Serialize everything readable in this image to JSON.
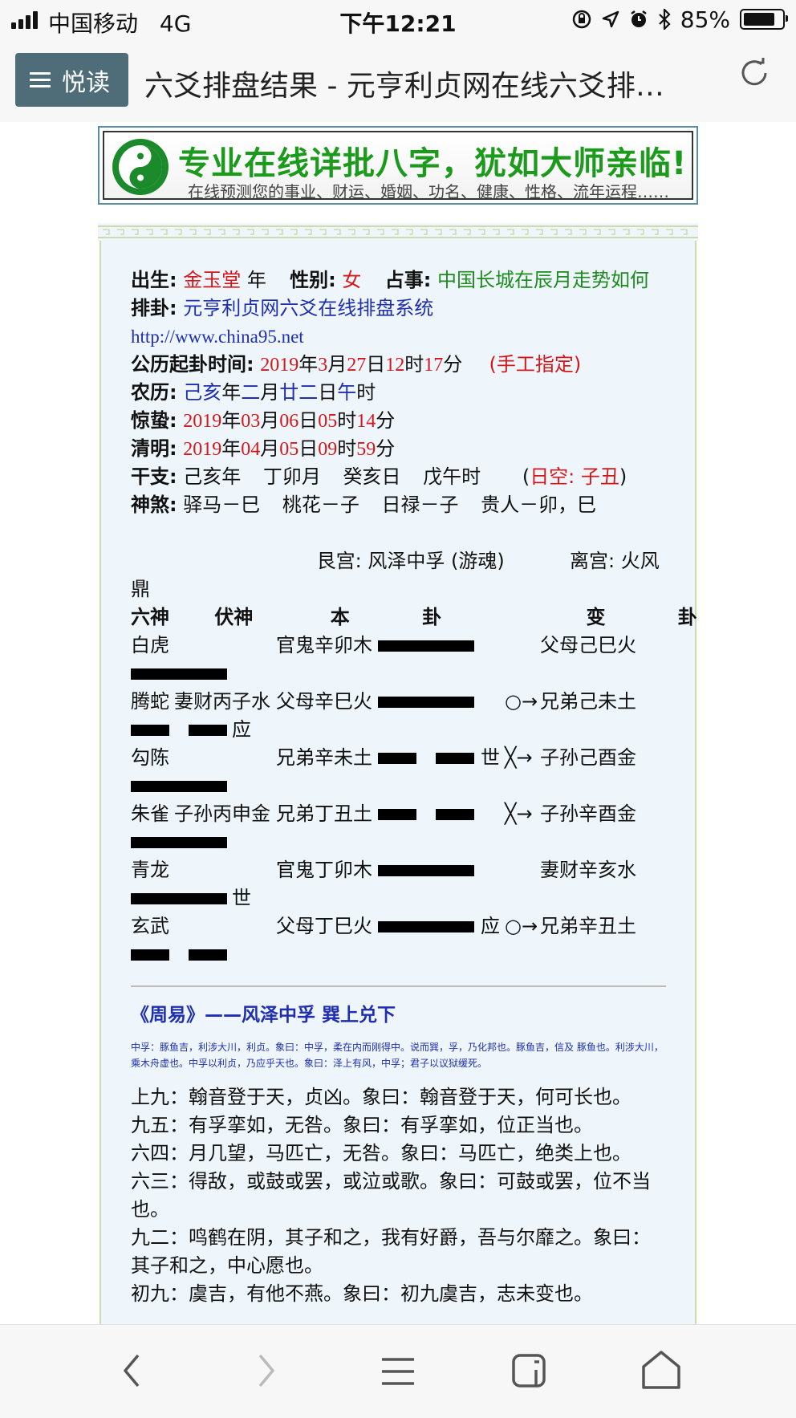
{
  "status": {
    "carrier": "中国移动",
    "network": "4G",
    "time": "下午12:21",
    "battery": "85%"
  },
  "browser": {
    "read_label": "悦读",
    "title": "六爻排盘结果 - 元亨利贞网在线六爻排…"
  },
  "banner": {
    "headline": "专业在线详批八字，犹如大师亲临!",
    "subline": "在线预测您的事业、财运、婚姻、功名、健康、性格、流年运程……"
  },
  "info": {
    "birth_label": "出生:",
    "birth_value": "金玉堂",
    "birth_suffix": "年",
    "sex_label": "性别:",
    "sex_value": "女",
    "matter_label": "占事:",
    "matter_value": "中国长城在辰月走势如何",
    "paigua_label": "排卦:",
    "paigua_value": "元亨利贞网六爻在线排盘系统",
    "url": "http://www.china95.net",
    "solar_label": "公历起卦时间:",
    "solar_year": "2019",
    "solar_month": "3",
    "solar_day": "27",
    "solar_hour": "12",
    "solar_min": "17",
    "solar_note": "(手工指定)",
    "lunar_label": "农历:",
    "lunar_year": "己亥",
    "lunar_month": "二",
    "lunar_day": "廿二",
    "lunar_hour": "午",
    "jingzhe_label": "惊蛰:",
    "jingzhe": [
      "2019",
      "03",
      "06",
      "05",
      "14"
    ],
    "qingming_label": "清明:",
    "qingming": [
      "2019",
      "04",
      "05",
      "09",
      "59"
    ],
    "ganzhi_label": "干支:",
    "ganzhi_year": "己亥年",
    "ganzhi_month": "丁卯月",
    "ganzhi_day": "癸亥日",
    "ganzhi_hour": "戊午时",
    "rikong_open": "(",
    "rikong": "日空: 子丑",
    "rikong_close": ")",
    "shensha_label": "神煞:",
    "shensha": [
      "驿马－巳",
      "桃花－子",
      "日禄－子",
      "贵人－卯，巳"
    ]
  },
  "gua": {
    "ben_palace": "艮宫: 风泽中孚 (游魂)",
    "bian_palace": "离宫: 火风",
    "bian_wrap": "鼎",
    "headers": {
      "liushen": "六神",
      "fushen": "伏神",
      "ben1": "本",
      "ben2": "卦",
      "bian1": "变",
      "bian2": "卦"
    },
    "rows": [
      {
        "liushen": "白虎",
        "fushen": "",
        "ben": "官鬼辛卯木",
        "ben_line": "yang",
        "mark": "",
        "dong": "",
        "bian": "父母己巳火",
        "bian_line": "yang",
        "bian_mark": ""
      },
      {
        "liushen": "腾蛇",
        "fushen": "妻财丙子水",
        "ben": "父母辛巳火",
        "ben_line": "yang",
        "mark": "",
        "dong": "○→",
        "bian": "兄弟己未土",
        "bian_line": "yin",
        "bian_mark": "应"
      },
      {
        "liushen": "勾陈",
        "fushen": "",
        "ben": "兄弟辛未土",
        "ben_line": "yin",
        "mark": "世",
        "dong": "╳→",
        "bian": "子孙己酉金",
        "bian_line": "yang",
        "bian_mark": ""
      },
      {
        "liushen": "朱雀",
        "fushen": "子孙丙申金",
        "ben": "兄弟丁丑土",
        "ben_line": "yin",
        "mark": "",
        "dong": "╳→",
        "bian": "子孙辛酉金",
        "bian_line": "yang",
        "bian_mark": ""
      },
      {
        "liushen": "青龙",
        "fushen": "",
        "ben": "官鬼丁卯木",
        "ben_line": "yang",
        "mark": "",
        "dong": "",
        "bian": "妻财辛亥水",
        "bian_line": "yang",
        "bian_mark": "世"
      },
      {
        "liushen": "玄武",
        "fushen": "",
        "ben": "父母丁巳火",
        "ben_line": "yang",
        "mark": "应",
        "dong": "○→",
        "bian": "兄弟辛丑土",
        "bian_line": "yin",
        "bian_mark": ""
      }
    ]
  },
  "zhouyi": {
    "title": "《周易》——风泽中孚 巽上兑下",
    "text": "中孚：豚鱼吉，利涉大川，利贞。象曰：中孚，柔在内而刚得中。说而巽，孚，乃化邦也。豚鱼吉，信及 豚鱼也。利涉大川，乘木舟虚也。中孚以利贞，乃应乎天也。象曰：泽上有风，中孚；君子以议狱缓死。",
    "lines": [
      "上九：翰音登于天，贞凶。象曰：翰音登于天，何可长也。",
      "九五：有孚挛如，无咎。象曰：有孚挛如，位正当也。",
      "六四：月几望，马匹亡，无咎。象曰：马匹亡，绝类上也。",
      "六三：得敌，或鼓或罢，或泣或歌。象曰：可鼓或罢，位不当也。",
      "九二：鸣鹤在阴，其子和之，我有好爵，吾与尔靡之。象曰：其子和之，中心愿也。",
      "初九：虞吉，有他不燕。象曰：初九虞吉，志未变也。"
    ]
  },
  "nav": {
    "icons": [
      "back-icon",
      "forward-icon",
      "menu-icon",
      "tabs-icon",
      "home-icon"
    ]
  }
}
